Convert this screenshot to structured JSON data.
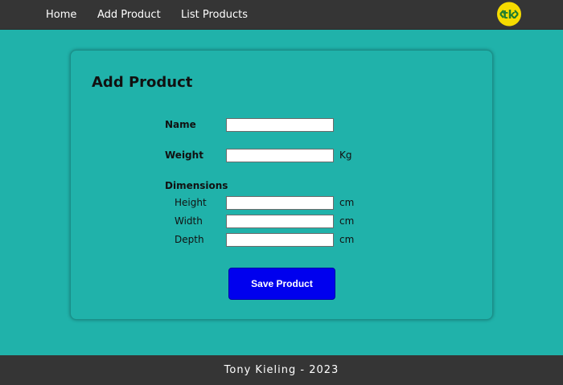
{
  "nav": {
    "home": "Home",
    "add_product": "Add Product",
    "list_products": "List Products",
    "logo_text": "tk"
  },
  "form": {
    "title": "Add Product",
    "name_label": "Name",
    "name_value": "",
    "weight_label": "Weight",
    "weight_value": "",
    "weight_unit": "Kg",
    "dimensions_label": "Dimensions",
    "height_label": "Height",
    "height_value": "",
    "height_unit": "cm",
    "width_label": "Width",
    "width_value": "",
    "width_unit": "cm",
    "depth_label": "Depth",
    "depth_value": "",
    "depth_unit": "cm",
    "save_button": "Save Product"
  },
  "footer": {
    "text": "Tony Kieling - 2023"
  },
  "colors": {
    "background": "#20b2aa",
    "nav_background": "#353535",
    "button": "#0000ee",
    "logo_yellow": "#f6dc00"
  }
}
